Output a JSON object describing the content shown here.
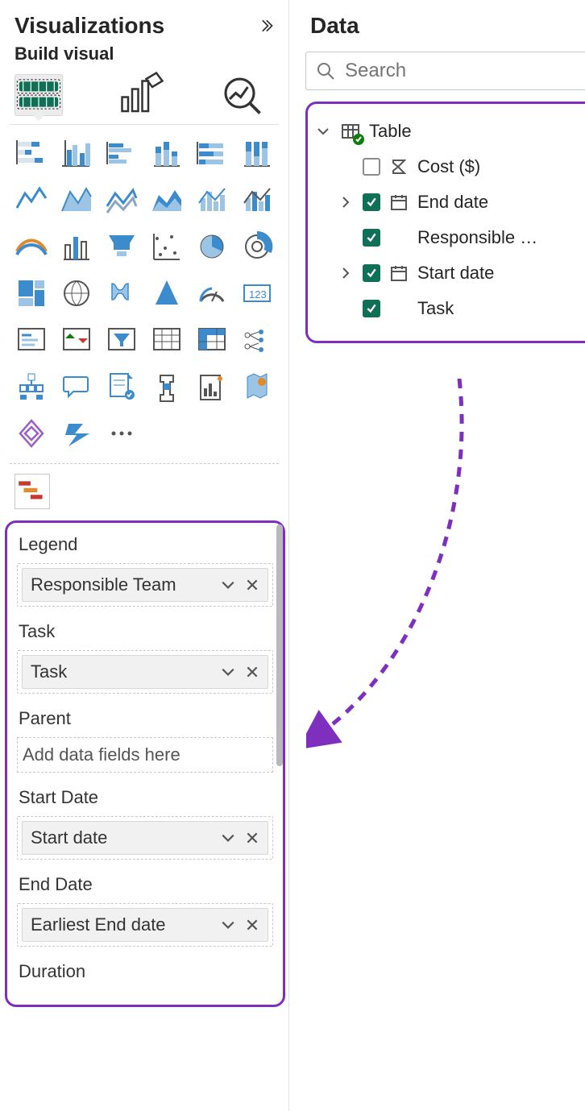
{
  "viz_pane": {
    "title": "Visualizations",
    "sub_title": "Build visual",
    "tabs": [
      "build",
      "format",
      "analytics"
    ],
    "selected_tab": "build",
    "gallery_icons": [
      "stacked-bar",
      "clustered-bar",
      "stacked-column",
      "clustered-column",
      "100-stacked-bar",
      "100-stacked-column",
      "line",
      "area",
      "stacked-area",
      "line-stacked-column",
      "line-clustered-column",
      "ribbon",
      "waterfall",
      "funnel",
      "scatter",
      "pie",
      "donut",
      "treemap",
      "map",
      "filled-map",
      "azure-map",
      "arcgis",
      "gauge",
      "card",
      "multi-row-card",
      "kpi",
      "slicer",
      "table",
      "matrix",
      "r-visual",
      "python-visual",
      "qna",
      "key-influencers",
      "decomposition-tree",
      "smart-narrative",
      "paginated",
      "power-apps",
      "power-automate",
      "more"
    ],
    "custom_visual": "gantt",
    "wells": [
      {
        "label": "Legend",
        "type": "chip",
        "value": "Responsible Team"
      },
      {
        "label": "Task",
        "type": "chip",
        "value": "Task"
      },
      {
        "label": "Parent",
        "type": "empty",
        "placeholder": "Add data fields here"
      },
      {
        "label": "Start Date",
        "type": "chip",
        "value": "Start date"
      },
      {
        "label": "End Date",
        "type": "chip",
        "value": "Earliest End date"
      },
      {
        "label": "Duration",
        "type": "none"
      }
    ]
  },
  "data_pane": {
    "title": "Data",
    "search_placeholder": "Search",
    "table": {
      "name": "Table",
      "fields": [
        {
          "name": "Cost ($)",
          "checked": false,
          "icon": "sigma",
          "expand": "none"
        },
        {
          "name": "End date",
          "checked": true,
          "icon": "calendar",
          "expand": "right"
        },
        {
          "name": "Responsible …",
          "checked": true,
          "icon": "none",
          "expand": "none",
          "more": true
        },
        {
          "name": "Start date",
          "checked": true,
          "icon": "calendar",
          "expand": "right"
        },
        {
          "name": "Task",
          "checked": true,
          "icon": "none",
          "expand": "none"
        }
      ]
    }
  }
}
